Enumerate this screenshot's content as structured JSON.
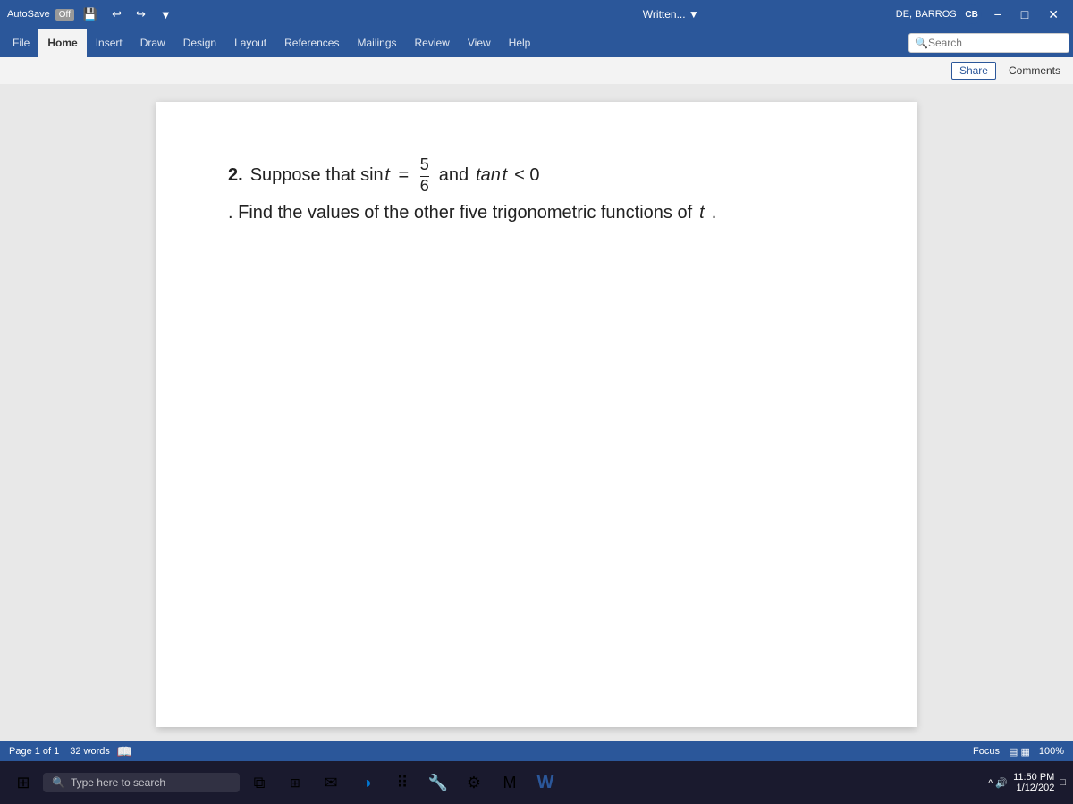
{
  "titlebar": {
    "autosave": "AutoSave",
    "autosave_state": "Off",
    "doc_title": "Written...",
    "undo_icon": "↩",
    "redo_icon": "↪",
    "user_initials": "CB",
    "user_name": "DE, BARROS",
    "minimize": "−",
    "maximize": "□",
    "close": "✕"
  },
  "ribbon": {
    "tabs": [
      "File",
      "Home",
      "Insert",
      "Draw",
      "Design",
      "Layout",
      "References",
      "Mailings",
      "Review",
      "View",
      "Help"
    ],
    "active_tab": "Home",
    "search_placeholder": "Search",
    "share_label": "Share",
    "comments_label": "Comments"
  },
  "problem": {
    "number": "2.",
    "intro": "Suppose that sin",
    "var_t": "t",
    "eq": "=",
    "numerator": "5",
    "denominator": "6",
    "connector": "and",
    "tan_part": "tan",
    "var_t2": "t",
    "inequality": "< 0",
    "rest": ". Find the values of the other five trigonometric functions of",
    "var_t3": "t",
    "period": "."
  },
  "statusbar": {
    "page_info": "Page 1 of 1",
    "words": "32 words",
    "focus_label": "Focus",
    "zoom_level": "100%"
  },
  "taskbar": {
    "start_icon": "⊞",
    "search_text": "Type here to search",
    "clock_time": "11:50 PM",
    "clock_date": "1/12/202"
  }
}
